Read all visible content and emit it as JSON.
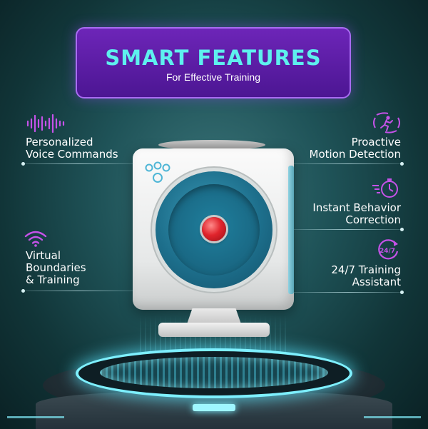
{
  "header": {
    "title": "SMART FEATURES",
    "subtitle": "For Effective Training"
  },
  "features": {
    "voice": {
      "line1": "Personalized",
      "line2": "Voice Commands",
      "icon": "sound-wave-icon"
    },
    "motion": {
      "line1": "Proactive",
      "line2": "Motion Detection",
      "icon": "running-person-icon"
    },
    "boundaries": {
      "line1": "Virtual",
      "line2": "Boundaries",
      "line3": "& Training",
      "icon": "wifi-signal-icon"
    },
    "correction": {
      "line1": "Instant Behavior",
      "line2": "Correction",
      "icon": "stopwatch-icon"
    },
    "assistant": {
      "line1": "24/7 Training",
      "line2": "Assistant",
      "icon": "24-7-cycle-icon",
      "badge": "24/7"
    }
  },
  "colors": {
    "title": "#5ef0ee",
    "banner": "#5a1ca6",
    "icons": "#c552e8",
    "glow": "#7ef0ff"
  }
}
